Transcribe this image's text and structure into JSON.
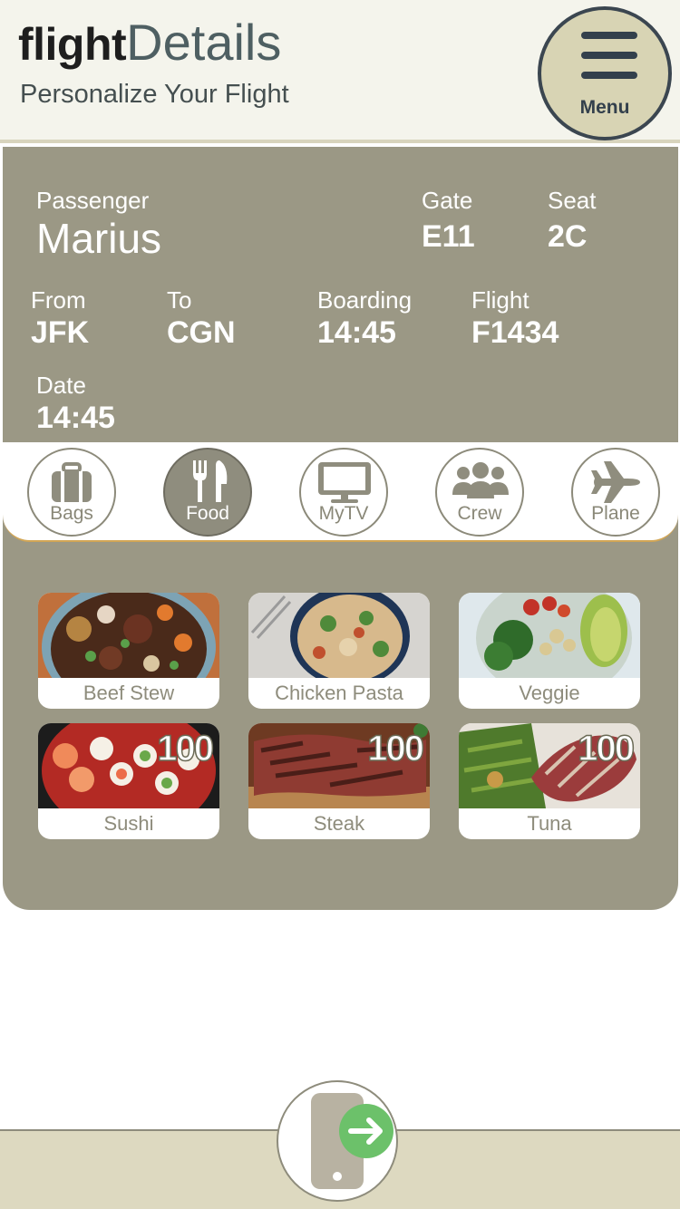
{
  "header": {
    "brand_bold": "flight",
    "brand_light": "Details",
    "subtitle": "Personalize Your Flight",
    "menu_label": "Menu"
  },
  "ticket": {
    "passenger_label": "Passenger",
    "passenger_name": "Marius",
    "gate_label": "Gate",
    "gate_value": "E11",
    "seat_label": "Seat",
    "seat_value": "2C",
    "from_label": "From",
    "from_value": "JFK",
    "to_label": "To",
    "to_value": "CGN",
    "boarding_label": "Boarding",
    "boarding_value": "14:45",
    "flight_label": "Flight",
    "flight_value": "F1434",
    "date_label": "Date",
    "date_value": "14:45"
  },
  "tabs": [
    {
      "label": "Bags",
      "icon": "luggage-icon",
      "active": false
    },
    {
      "label": "Food",
      "icon": "cutlery-icon",
      "active": true
    },
    {
      "label": "MyTV",
      "icon": "monitor-icon",
      "active": false
    },
    {
      "label": "Crew",
      "icon": "people-icon",
      "active": false
    },
    {
      "label": "Plane",
      "icon": "airplane-icon",
      "active": false
    }
  ],
  "food_items": [
    {
      "label": "Beef Stew",
      "count": ""
    },
    {
      "label": "Chicken Pasta",
      "count": ""
    },
    {
      "label": "Veggie",
      "count": ""
    },
    {
      "label": "Sushi",
      "count": "100"
    },
    {
      "label": "Steak",
      "count": "100"
    },
    {
      "label": "Tuna",
      "count": "100"
    }
  ],
  "footer": {
    "action_icon": "phone-exit-icon"
  },
  "colors": {
    "card_bg": "#9b9885",
    "header_bg": "#f4f4ec",
    "menu_bg": "#d8d4b4",
    "active_tab": "#8f8d7e",
    "accent_green": "#6cc16a"
  }
}
